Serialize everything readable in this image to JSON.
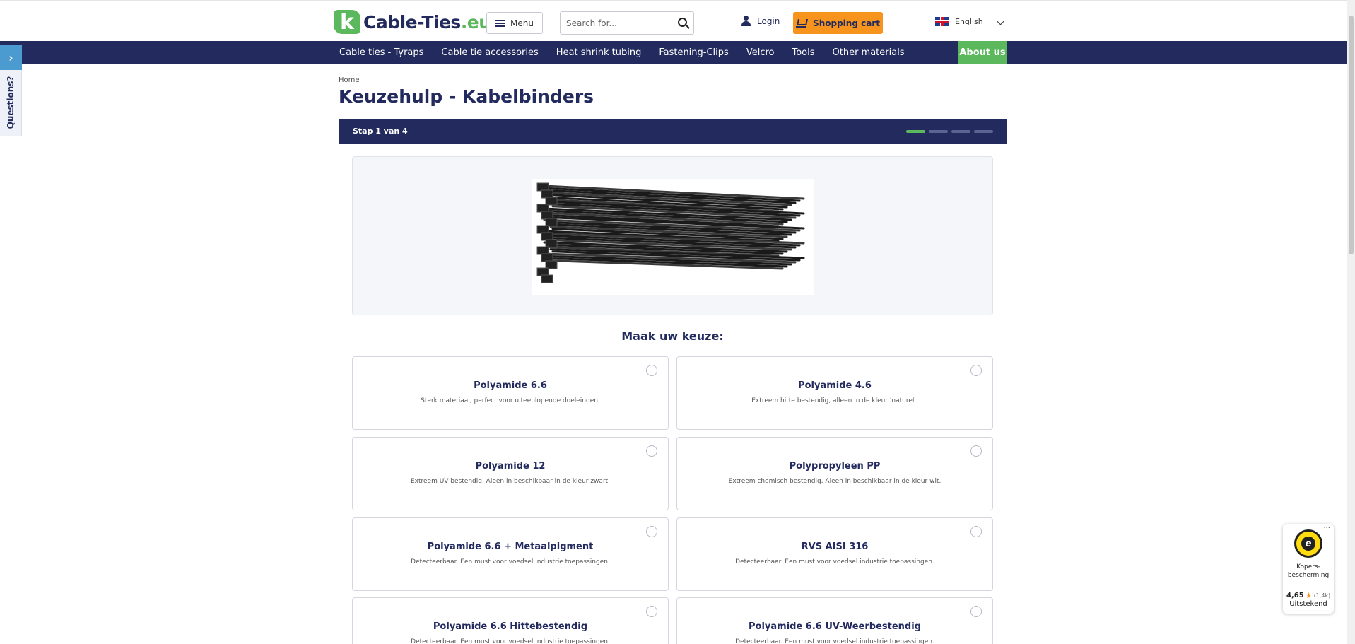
{
  "header": {
    "logo_name": "Cable-Ties",
    "logo_tld": ".eu",
    "menu_label": "Menu",
    "search_placeholder": "Search for...",
    "login_label": "Login",
    "cart_label": "Shopping cart",
    "language": "English"
  },
  "nav": {
    "items": [
      "Cable ties - Tyraps",
      "Cable tie accessories",
      "Heat shrink tubing",
      "Fastening-Clips",
      "Velcro",
      "Tools",
      "Other materials"
    ],
    "about": "About us"
  },
  "side": {
    "arrow": "›",
    "label": "Questions?"
  },
  "page": {
    "breadcrumb": "Home",
    "title": "Keuzehulp - Kabelbinders",
    "step": "Stap 1 van 4",
    "step_current": 1,
    "step_total": 4,
    "choose_label": "Maak uw keuze:"
  },
  "options": [
    {
      "title": "Polyamide 6.6",
      "desc": "Sterk materiaal, perfect voor uiteenlopende doeleinden."
    },
    {
      "title": "Polyamide 4.6",
      "desc": "Extreem hitte bestendig, alleen in de kleur 'naturel'."
    },
    {
      "title": "Polyamide 12",
      "desc": "Extreem UV bestendig. Aleen in beschikbaar in de kleur zwart."
    },
    {
      "title": "Polypropyleen PP",
      "desc": "Extreem chemisch bestendig. Aleen in beschikbaar in de kleur wit."
    },
    {
      "title": "Polyamide 6.6 + Metaalpigment",
      "desc": "Detecteerbaar. Een must voor voedsel industrie toepassingen."
    },
    {
      "title": "RVS AISI 316",
      "desc": "Detecteerbaar. Een must voor voedsel industrie toepassingen."
    },
    {
      "title": "Polyamide 6.6 Hittebestendig",
      "desc": "Detecteerbaar. Een must voor voedsel industrie toepassingen."
    },
    {
      "title": "Polyamide 6.6 UV-Weerbestendig",
      "desc": "Detecteerbaar. Een must voor voedsel industrie toepassingen."
    }
  ],
  "trust": {
    "more": "...",
    "seal_letter": "e",
    "label_line1": "Kopers-",
    "label_line2": "bescherming",
    "score": "4,65",
    "star": "★",
    "count": "(1,4k)",
    "grade": "Uitstekend"
  },
  "colors": {
    "navy": "#222a5e",
    "green": "#5cb85c",
    "orange": "#f7941d"
  }
}
